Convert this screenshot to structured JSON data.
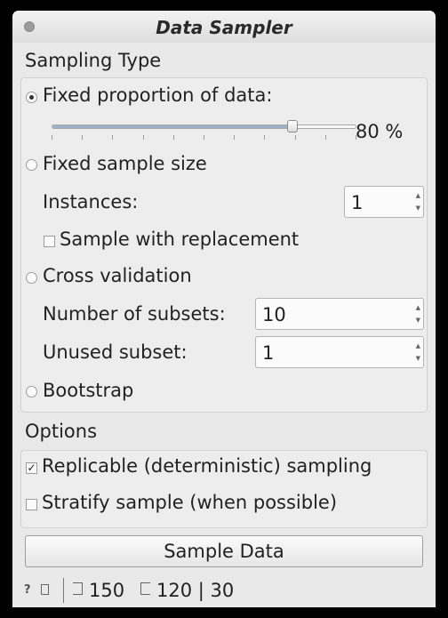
{
  "window": {
    "title": "Data Sampler"
  },
  "sampling": {
    "label": "Sampling Type",
    "fixed_proportion": {
      "label": "Fixed proportion of data:",
      "selected": true
    },
    "proportion_value": "80 %",
    "proportion_fraction": 0.8,
    "fixed_size": {
      "label": "Fixed sample size",
      "selected": false
    },
    "instances": {
      "label": "Instances:",
      "value": "1"
    },
    "replacement": {
      "label": "Sample with replacement",
      "checked": false
    },
    "cross_validation": {
      "label": "Cross validation",
      "selected": false
    },
    "subsets": {
      "label": "Number of subsets:",
      "value": "10"
    },
    "unused": {
      "label": "Unused subset:",
      "value": "1"
    },
    "bootstrap": {
      "label": "Bootstrap",
      "selected": false
    }
  },
  "options": {
    "label": "Options",
    "replicable": {
      "label": "Replicable (deterministic) sampling",
      "checked": true,
      "mark": "✓"
    },
    "stratify": {
      "label": "Stratify sample (when possible)",
      "checked": false
    }
  },
  "actions": {
    "sample_label": "Sample Data"
  },
  "status": {
    "help_glyph": "?",
    "input_count": "150",
    "output_text": "120 | 30"
  }
}
